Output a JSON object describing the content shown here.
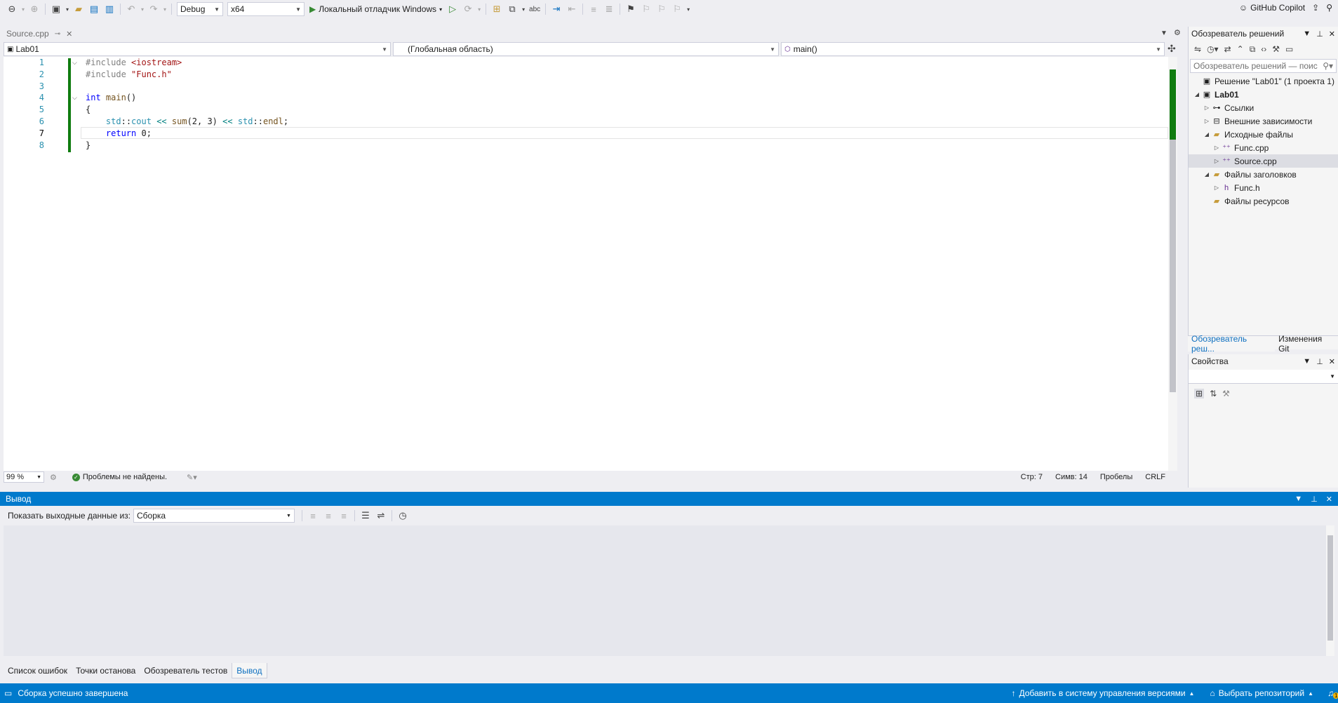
{
  "toolbar": {
    "config": "Debug",
    "platform": "x64",
    "run_label": "Локальный отладчик Windows",
    "copilot_label": "GitHub Copilot"
  },
  "editor": {
    "tab_label": "Source.cpp",
    "nav": {
      "project": "Lab01",
      "scope": "(Глобальная область)",
      "member": "main()"
    },
    "line_numbers": [
      "1",
      "2",
      "3",
      "4",
      "5",
      "6",
      "7",
      "8"
    ],
    "current_line": "7",
    "status": {
      "zoom": "99 %",
      "issues": "Проблемы не найдены.",
      "line": "Стр: 7",
      "col": "Симв: 14",
      "indent": "Пробелы",
      "eol": "CRLF"
    }
  },
  "solution_explorer": {
    "title": "Обозреватель решений",
    "search_placeholder": "Обозреватель решений — поис",
    "items": [
      {
        "label": "Решение \"Lab01\" (1 проекта 1)"
      },
      {
        "label": "Lab01"
      },
      {
        "label": "Ссылки"
      },
      {
        "label": "Внешние зависимости"
      },
      {
        "label": "Исходные файлы"
      },
      {
        "label": "Func.cpp"
      },
      {
        "label": "Source.cpp"
      },
      {
        "label": "Файлы заголовков"
      },
      {
        "label": "Func.h"
      },
      {
        "label": "Файлы ресурсов"
      }
    ],
    "tabs": [
      "Обозреватель реш...",
      "Изменения Git"
    ]
  },
  "properties": {
    "title": "Свойства"
  },
  "output": {
    "title": "Вывод",
    "show_from_label": "Показать выходные данные из:",
    "source": "Сборка"
  },
  "bottom_tabs": [
    "Список ошибок",
    "Точки останова",
    "Обозреватель тестов",
    "Вывод"
  ],
  "statusbar": {
    "message": "Сборка успешно завершена",
    "add_vcs": "Добавить в систему управления версиями",
    "select_repo": "Выбрать репозиторий",
    "notifications": "1"
  },
  "colors": {
    "accent": "#007acc",
    "change_marker": "#107c10",
    "keyword": "#0000ff",
    "string": "#a31515"
  }
}
